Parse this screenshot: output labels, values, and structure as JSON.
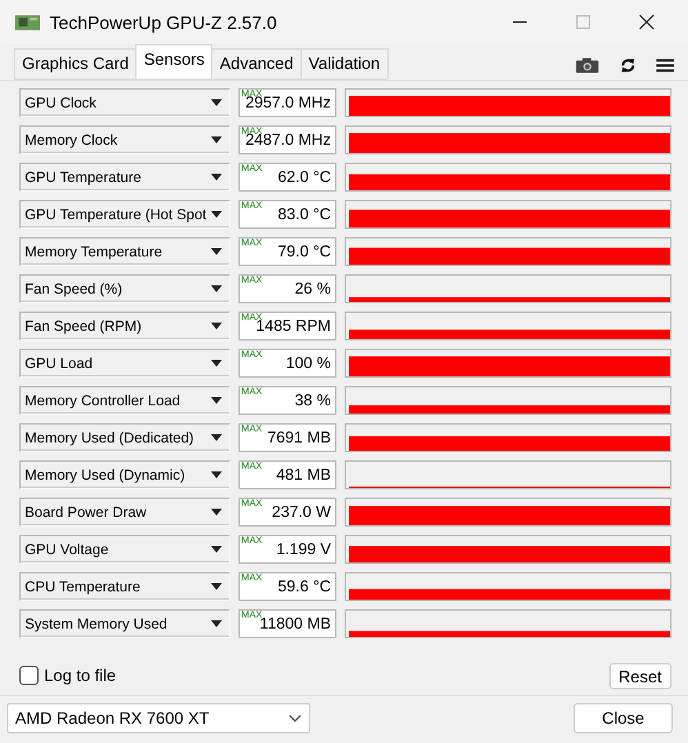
{
  "window": {
    "title": "TechPowerUp GPU-Z 2.57.0"
  },
  "tabs": [
    {
      "label": "Graphics Card",
      "selected": false
    },
    {
      "label": "Sensors",
      "selected": true
    },
    {
      "label": "Advanced",
      "selected": false
    },
    {
      "label": "Validation",
      "selected": false
    }
  ],
  "sensors": [
    {
      "name": "GPU Clock",
      "badge": "MAX",
      "value": "2957.0 MHz"
    },
    {
      "name": "Memory Clock",
      "badge": "MAX",
      "value": "2487.0 MHz"
    },
    {
      "name": "GPU Temperature",
      "badge": "MAX",
      "value": "62.0 °C"
    },
    {
      "name": "GPU Temperature (Hot Spot",
      "badge": "MAX",
      "value": "83.0 °C"
    },
    {
      "name": "Memory Temperature",
      "badge": "MAX",
      "value": "79.0 °C"
    },
    {
      "name": "Fan Speed (%)",
      "badge": "MAX",
      "value": "26 %"
    },
    {
      "name": "Fan Speed (RPM)",
      "badge": "MAX",
      "value": "1485 RPM"
    },
    {
      "name": "GPU Load",
      "badge": "MAX",
      "value": "100 %"
    },
    {
      "name": "Memory Controller Load",
      "badge": "MAX",
      "value": "38 %"
    },
    {
      "name": "Memory Used (Dedicated)",
      "badge": "MAX",
      "value": "7691 MB"
    },
    {
      "name": "Memory Used (Dynamic)",
      "badge": "MAX",
      "value": "481 MB"
    },
    {
      "name": "Board Power Draw",
      "badge": "MAX",
      "value": "237.0 W"
    },
    {
      "name": "GPU Voltage",
      "badge": "MAX",
      "value": "1.199 V"
    },
    {
      "name": "CPU Temperature",
      "badge": "MAX",
      "value": "59.6 °C"
    },
    {
      "name": "System Memory Used",
      "badge": "MAX",
      "value": "11800 MB"
    }
  ],
  "log_to_file": {
    "label": "Log to file",
    "checked": false
  },
  "reset_button": "Reset",
  "device_select": {
    "value": "AMD Radeon RX 7600 XT"
  },
  "close_button": "Close"
}
